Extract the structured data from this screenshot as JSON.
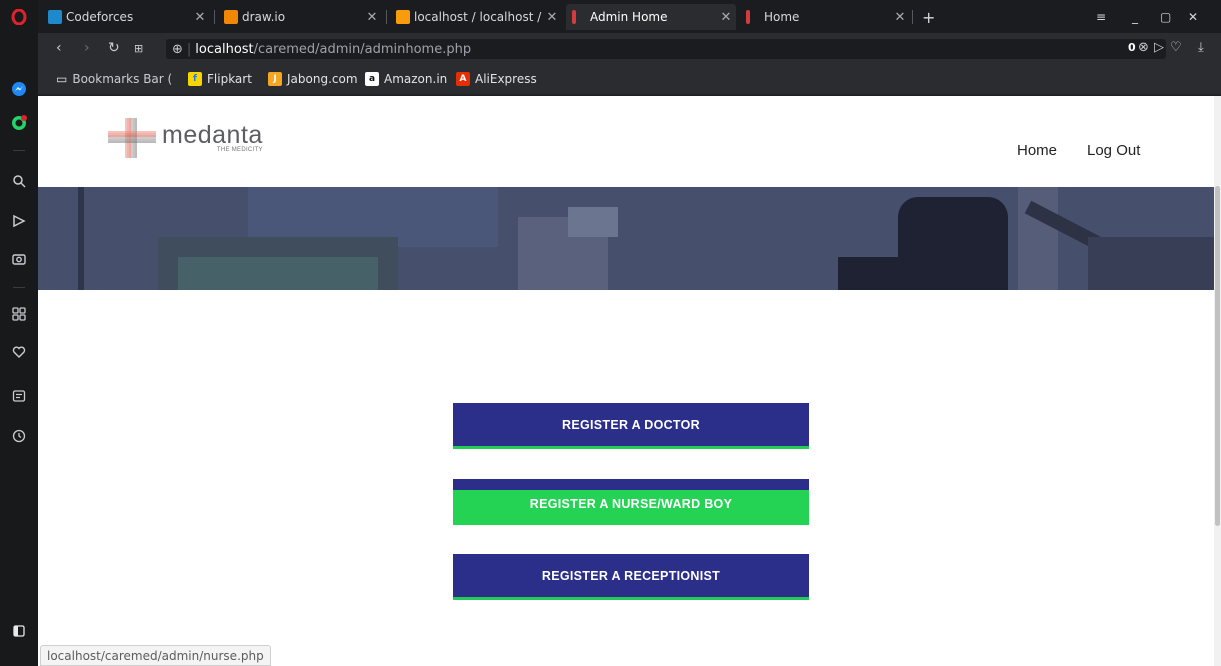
{
  "browser": {
    "tabs": [
      {
        "title": "Codeforces",
        "favicon_color": "#1f8acb"
      },
      {
        "title": "draw.io",
        "favicon_color": "#f08705"
      },
      {
        "title": "localhost / localhost /",
        "favicon_color": "#f89c0e"
      },
      {
        "title": "Admin Home",
        "favicon_color": "#d33c3c"
      },
      {
        "title": "Home",
        "favicon_color": "#d33c3c"
      }
    ],
    "new_tab_label": "+",
    "url_host": "localhost",
    "url_path": "/caremed/admin/adminhome.php",
    "adblock_count": "0",
    "bookmarks_folder": "Bookmarks Bar (",
    "bookmarks": [
      {
        "label": "Flipkart",
        "icon_color": "#f7d600",
        "glyph": "f"
      },
      {
        "label": "Jabong.com",
        "icon_color": "#f5a623",
        "glyph": "J"
      },
      {
        "label": "Amazon.in",
        "icon_color": "#ffffff",
        "glyph": "a"
      },
      {
        "label": "AliExpress",
        "icon_color": "#e62e04",
        "glyph": "A"
      }
    ],
    "status_url": "localhost/caremed/admin/nurse.php"
  },
  "site": {
    "logo_main": "medanta",
    "logo_sub": "THE MEDICITY",
    "nav": {
      "home": "Home",
      "logout": "Log Out"
    },
    "buttons": {
      "doctor": "REGISTER A DOCTOR",
      "nurse": "REGISTER A NURSE/WARD BOY",
      "receptionist": "REGISTER A RECEPTIONIST"
    },
    "colors": {
      "button_blue": "#2b2f8a",
      "button_green": "#25d354",
      "banner": "#434b69"
    }
  }
}
